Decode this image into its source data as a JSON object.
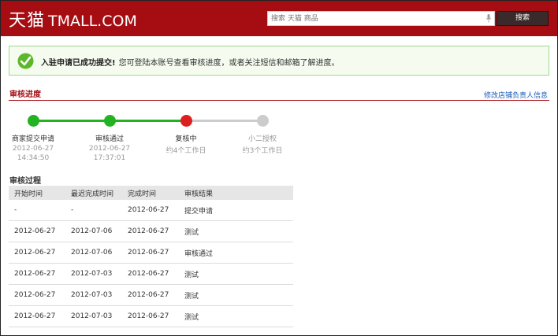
{
  "header": {
    "logo_cn": "天猫",
    "logo_latin": "TMALL.COM",
    "search_placeholder": "搜索 天猫 商品",
    "search_button": "搜索",
    "brand_color": "#a50d13"
  },
  "notice": {
    "title": "入驻申请已成功提交!",
    "text": "您可登陆本账号查看审核进度，或者关注短信和邮箱了解进度。",
    "icon": "check-icon"
  },
  "progress_section": {
    "title": "审核进度",
    "link": "修改店铺负责人信息",
    "steps": [
      {
        "label": "商家提交申请",
        "line1": "2012-06-27",
        "line2": "14:34:50",
        "state": "done"
      },
      {
        "label": "审核通过",
        "line1": "2012-06-27",
        "line2": "17:37:01",
        "state": "done"
      },
      {
        "label": "复核中",
        "line1": "约4个工作日",
        "line2": "",
        "state": "current"
      },
      {
        "label": "小二授权",
        "line1": "约3个工作日",
        "line2": "",
        "state": "pending"
      }
    ],
    "colors": {
      "done": "#22b322",
      "current": "#dd1f1f",
      "pending": "#cccccc"
    }
  },
  "process_section": {
    "title": "审核过程",
    "columns": [
      "开始时间",
      "最迟完成时间",
      "完成时间",
      "审核结果"
    ],
    "rows": [
      [
        "-",
        "-",
        "2012-06-27",
        "提交申请"
      ],
      [
        "2012-06-27",
        "2012-07-06",
        "2012-06-27",
        "测试"
      ],
      [
        "2012-06-27",
        "2012-07-06",
        "2012-06-27",
        "审核通过"
      ],
      [
        "2012-06-27",
        "2012-07-03",
        "2012-06-27",
        "测试"
      ],
      [
        "2012-06-27",
        "2012-07-03",
        "2012-06-27",
        "测试"
      ],
      [
        "2012-06-27",
        "2012-07-03",
        "2012-06-27",
        "测试"
      ]
    ]
  }
}
